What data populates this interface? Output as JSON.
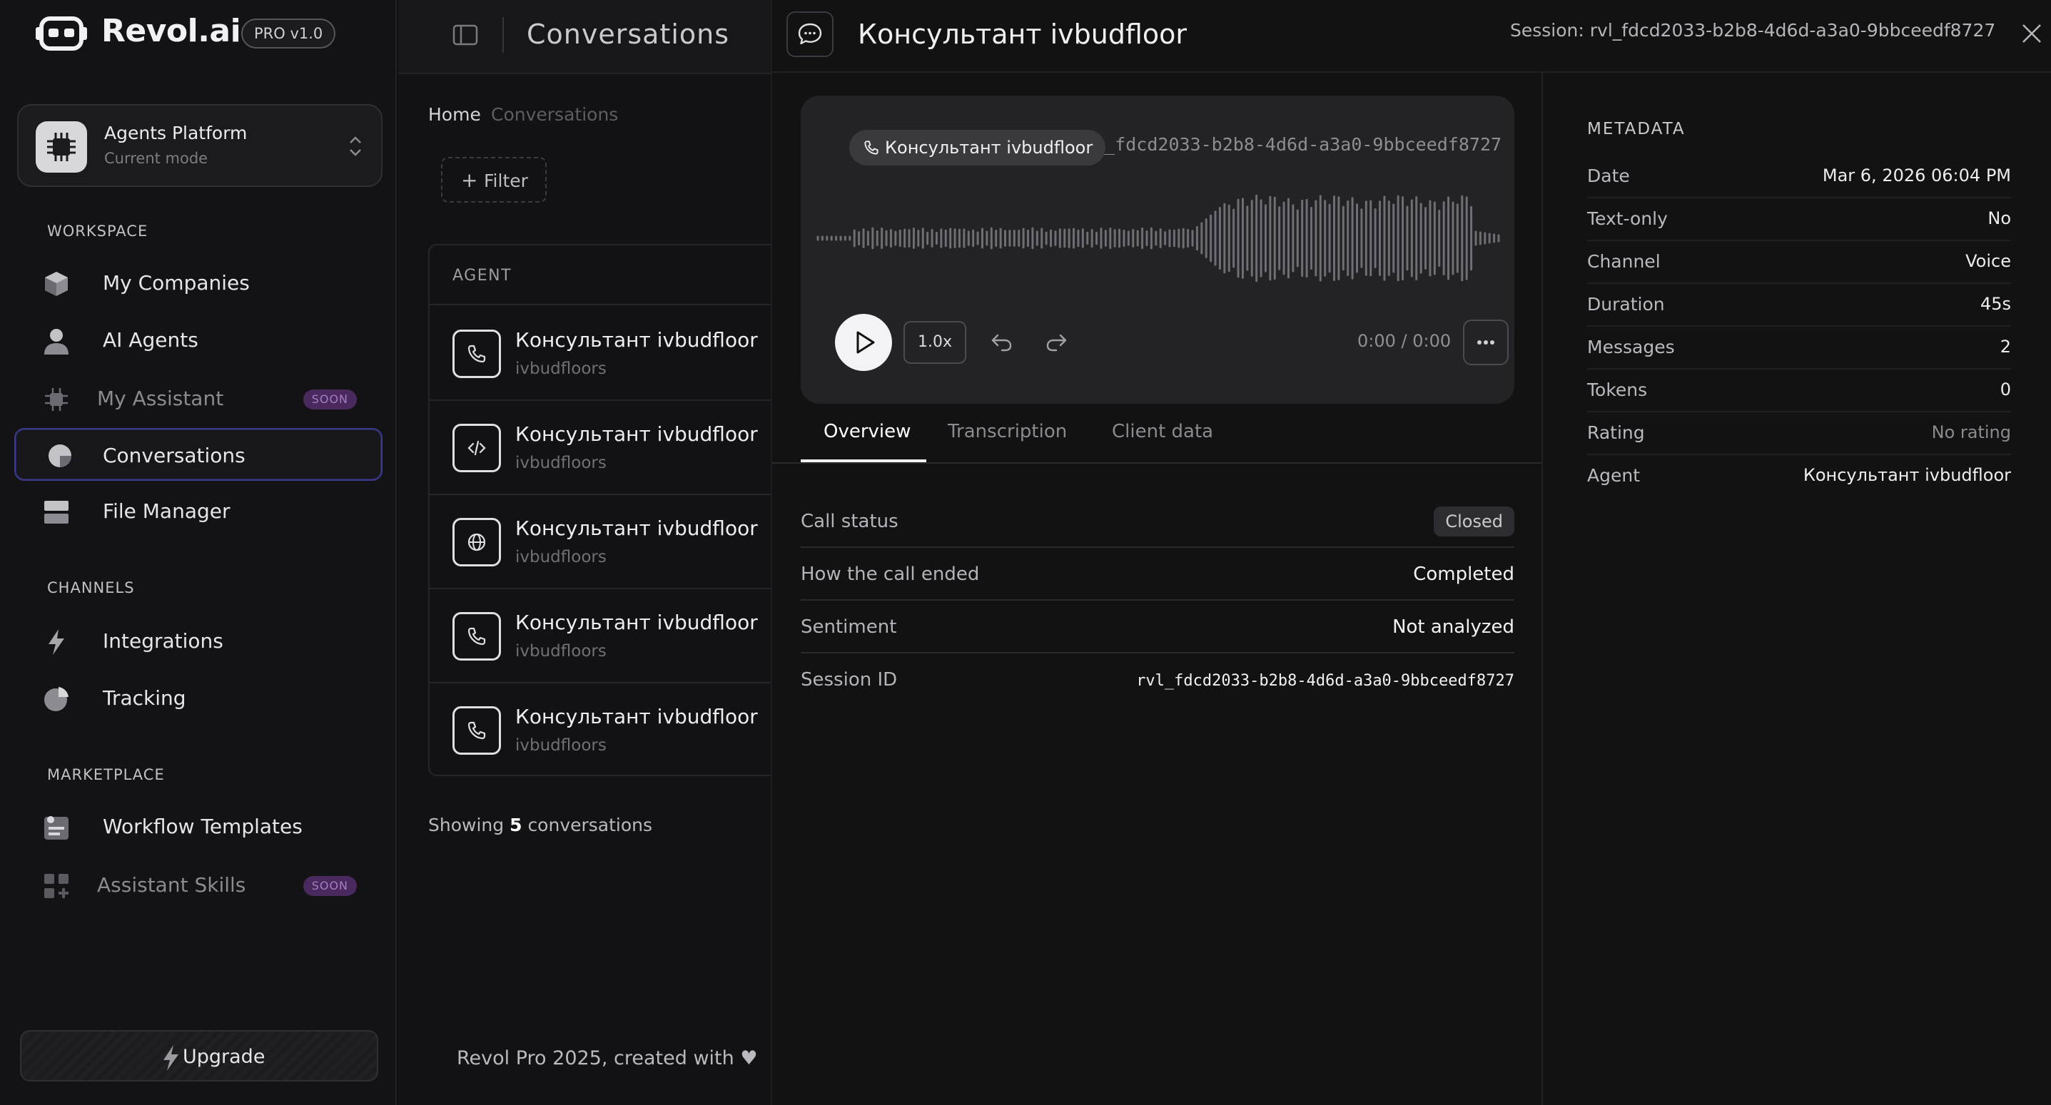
{
  "brand": {
    "name": "Revol.ai",
    "badge": "PRO v1.0"
  },
  "mode": {
    "title": "Agents Platform",
    "subtitle": "Current mode"
  },
  "sidebar": {
    "sections": {
      "workspace": "WORKSPACE",
      "channels": "CHANNELS",
      "marketplace": "MARKETPLACE"
    },
    "items": [
      {
        "label": "My Companies"
      },
      {
        "label": "AI Agents"
      },
      {
        "label": "My Assistant",
        "badge": "SOON"
      },
      {
        "label": "Conversations"
      },
      {
        "label": "File Manager"
      },
      {
        "label": "Integrations"
      },
      {
        "label": "Tracking"
      },
      {
        "label": "Workflow Templates"
      },
      {
        "label": "Assistant Skills",
        "badge": "SOON"
      }
    ],
    "upgrade": "Upgrade"
  },
  "middle": {
    "title": "Conversations",
    "breadcrumb": {
      "home": "Home",
      "current": "Conversations"
    },
    "filter": "Filter",
    "column": "AGENT",
    "rows": [
      {
        "title": "Консультант ivbudfloor",
        "sub": "ivbudfloors",
        "icon": "phone-icon"
      },
      {
        "title": "Консультант ivbudfloor",
        "sub": "ivbudfloors",
        "icon": "code-icon"
      },
      {
        "title": "Консультант ivbudfloor",
        "sub": "ivbudfloors",
        "icon": "globe-icon"
      },
      {
        "title": "Консультант ivbudfloor",
        "sub": "ivbudfloors",
        "icon": "phone-icon"
      },
      {
        "title": "Консультант ivbudfloor",
        "sub": "ivbudfloors",
        "icon": "phone-icon"
      }
    ],
    "showing": {
      "prefix": "Showing",
      "count": "5",
      "suffix": "conversations"
    },
    "footer": "Revol Pro 2025, created with"
  },
  "detail": {
    "title": "Консультант ivbudfloor",
    "session": "Session: rvl_fdcd2033-b2b8-4d6d-a3a0-9bbceedf8727",
    "player": {
      "pill": "Консультант ivbudfloor",
      "session_id": "rvl_fdcd2033-b2b8-4d6d-a3a0-9bbceedf8727",
      "speed": "1.0x",
      "time": "0:00 / 0:00"
    },
    "tabs": [
      "Overview",
      "Transcription",
      "Client data"
    ],
    "overview": [
      {
        "label": "Call status",
        "value": "Closed"
      },
      {
        "label": "How the call ended",
        "value": "Completed"
      },
      {
        "label": "Sentiment",
        "value": "Not analyzed"
      },
      {
        "label": "Session ID",
        "value": "rvl_fdcd2033-b2b8-4d6d-a3a0-9bbceedf8727"
      }
    ],
    "metadata": {
      "heading": "METADATA",
      "rows": [
        {
          "label": "Date",
          "value": "Mar 6, 2026 06:04 PM"
        },
        {
          "label": "Text-only",
          "value": "No"
        },
        {
          "label": "Channel",
          "value": "Voice"
        },
        {
          "label": "Duration",
          "value": "45s"
        },
        {
          "label": "Messages",
          "value": "2"
        },
        {
          "label": "Tokens",
          "value": "0"
        },
        {
          "label": "Rating",
          "value": "No rating"
        },
        {
          "label": "Agent",
          "value": "Консультант ivbudfloor"
        }
      ]
    }
  },
  "colors": {
    "accent_active": "#3a3a8c",
    "soon_badge": "#4a2a5e"
  }
}
